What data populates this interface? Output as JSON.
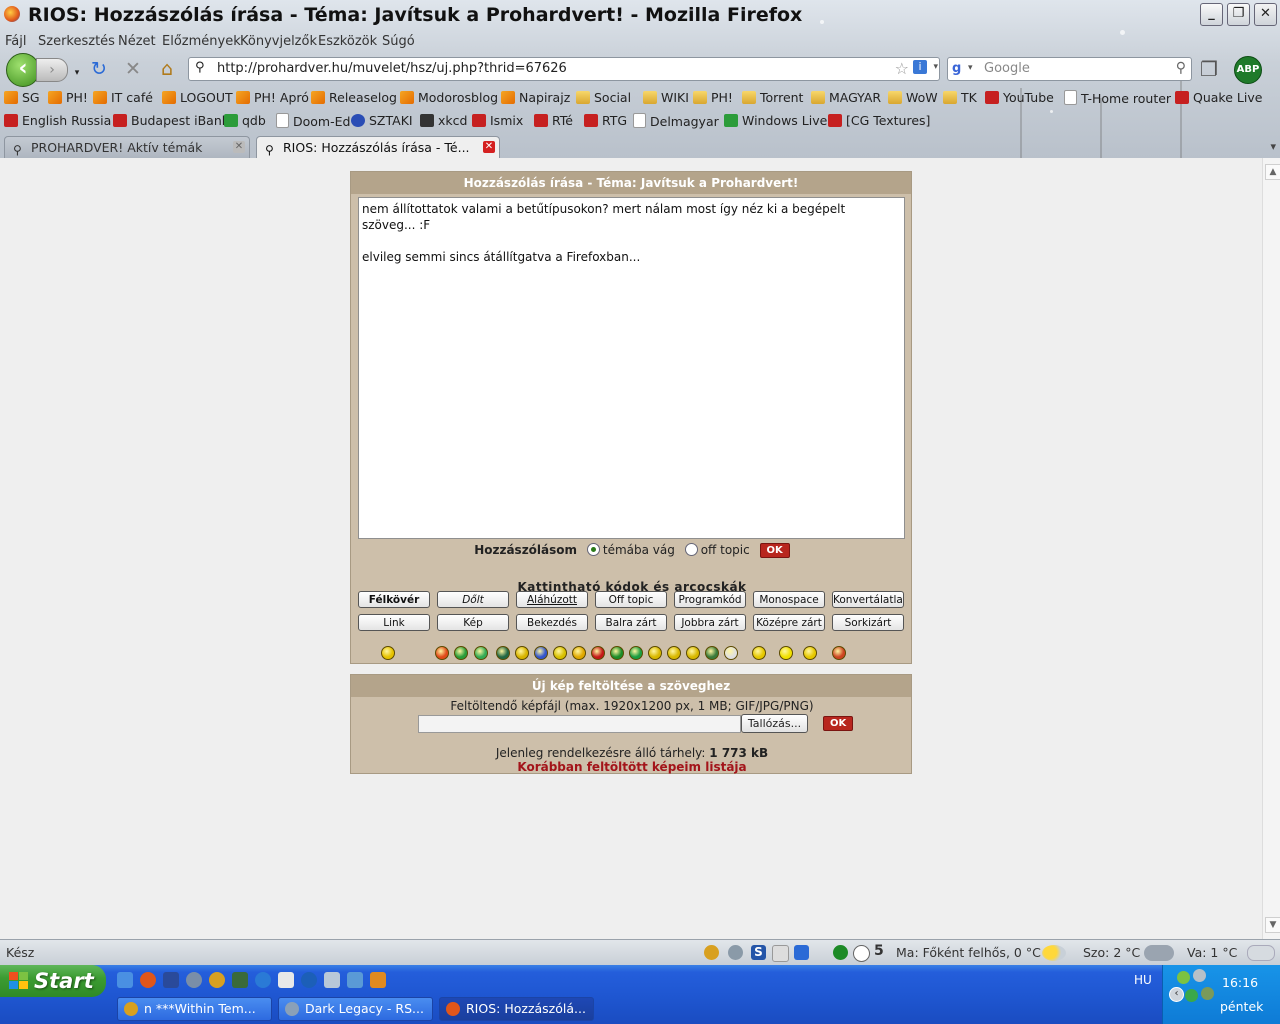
{
  "window": {
    "title": "RIOS: Hozzászólás írása - Téma: Javítsuk a Prohardvert! - Mozilla Firefox",
    "minimize": "_",
    "restore": "❐",
    "close": "✕"
  },
  "menu": [
    "Fájl",
    "Szerkesztés",
    "Nézet",
    "Előzmények",
    "Könyvjelzők",
    "Eszközök",
    "Súgó"
  ],
  "navigation": {
    "url": "http://prohardver.hu/muvelet/hsz/uj.php?thrid=67626",
    "search_placeholder": "Google",
    "abp": "ABP"
  },
  "bookmarks_row1": [
    {
      "label": "SG",
      "icon": "rss"
    },
    {
      "label": "PH!",
      "icon": "rss"
    },
    {
      "label": "IT café",
      "icon": "rss"
    },
    {
      "label": "LOGOUT",
      "icon": "rss"
    },
    {
      "label": "PH! Apró",
      "icon": "rss"
    },
    {
      "label": "Releaselog",
      "icon": "rss"
    },
    {
      "label": "Modorosblog",
      "icon": "rss"
    },
    {
      "label": "Napirajz",
      "icon": "rss"
    },
    {
      "label": "Social",
      "icon": "folder"
    },
    {
      "label": "WIKI",
      "icon": "folder"
    },
    {
      "label": "PH!",
      "icon": "folder"
    },
    {
      "label": "Torrent",
      "icon": "folder"
    },
    {
      "label": "MAGYAR",
      "icon": "folder"
    },
    {
      "label": "WoW",
      "icon": "folder"
    },
    {
      "label": "TK",
      "icon": "folder"
    },
    {
      "label": "YouTube",
      "icon": "youtube"
    },
    {
      "label": "T-Home router",
      "icon": "page"
    },
    {
      "label": "Quake Live",
      "icon": "red"
    }
  ],
  "bookmarks_row2": [
    {
      "label": "English Russia",
      "icon": "red"
    },
    {
      "label": "Budapest iBank",
      "icon": "red"
    },
    {
      "label": "qdb",
      "icon": "green"
    },
    {
      "label": "Doom-Ed",
      "icon": "page"
    },
    {
      "label": "SZTAKI",
      "icon": "blue"
    },
    {
      "label": "xkcd",
      "icon": "dark"
    },
    {
      "label": "Ismix",
      "icon": "red"
    },
    {
      "label": "RTé",
      "icon": "red"
    },
    {
      "label": "RTG",
      "icon": "red"
    },
    {
      "label": "Delmagyar",
      "icon": "page"
    },
    {
      "label": "Windows Live",
      "icon": "green"
    },
    {
      "label": "[CG Textures]",
      "icon": "red"
    }
  ],
  "tabs": [
    {
      "label": "PROHARDVER! Aktív témák",
      "active": false
    },
    {
      "label": "RIOS: Hozzászólás írása - Té...",
      "active": true
    }
  ],
  "post_form": {
    "header": "Hozzászólás írása - Téma: Javítsuk a Prohardvert!",
    "text": "nem állítottatok valami a betűtípusokon? mert nálam most így néz ki a begépelt szöveg... :F\n\nelvileg semmi sincs átállítgatva a Firefoxban...",
    "comment_label": "Hozzászólásom",
    "option_on_topic": "témába vág",
    "option_off_topic": "off topic",
    "ok": "OK",
    "codes_title": "Kattintható kódok és arcocskák",
    "code_buttons_row1": [
      "Félkövér",
      "Dőlt",
      "Aláhúzott",
      "Off topic",
      "Programkód",
      "Monospace",
      "Konvertálatlan"
    ],
    "code_buttons_row2": [
      "Link",
      "Kép",
      "Bekezdés",
      "Balra zárt",
      "Jobbra zárt",
      "Középre zárt",
      "Sorkizárt"
    ],
    "smiley_colors": [
      "#e6c200",
      "#e04a1a",
      "#2a9c3a",
      "#33aa55",
      "#226644",
      "#d8b400",
      "#3355cc",
      "#d8c000",
      "#e0a800",
      "#c41818",
      "#1c8c28",
      "#1a9c40",
      "#d8b800",
      "#d8b800",
      "#d8b800",
      "#3a7a3a",
      "#e0e0e0",
      "#e6c800",
      "#f0e000",
      "#e6c800",
      "#cc4422"
    ]
  },
  "upload_form": {
    "header": "Új kép feltöltése a szöveghez",
    "label": "Feltöltendő képfájl (max. 1920x1200 px, 1 MB; GIF/JPG/PNG)",
    "browse": "Tallózás...",
    "ok": "OK",
    "quota_label": "Jelenleg rendelkezésre álló tárhely:",
    "quota_value": "1 773 kB",
    "previous_images": "Korábban feltöltött képeim listája"
  },
  "statusbar": {
    "status": "Kész",
    "counter": "5",
    "weather_today": "Ma: Főként felhős, 0 °C",
    "weather_sat": "Szo: 2 °C",
    "weather_sun": "Va: 1 °C"
  },
  "taskbar": {
    "start": "Start",
    "tasks": [
      {
        "label": "n ***Within Tem...",
        "active": false
      },
      {
        "label": "Dark Legacy - RS...",
        "active": false
      },
      {
        "label": "RIOS: Hozzászólá...",
        "active": true
      }
    ],
    "lang": "HU",
    "time": "16:16",
    "day": "péntek"
  }
}
